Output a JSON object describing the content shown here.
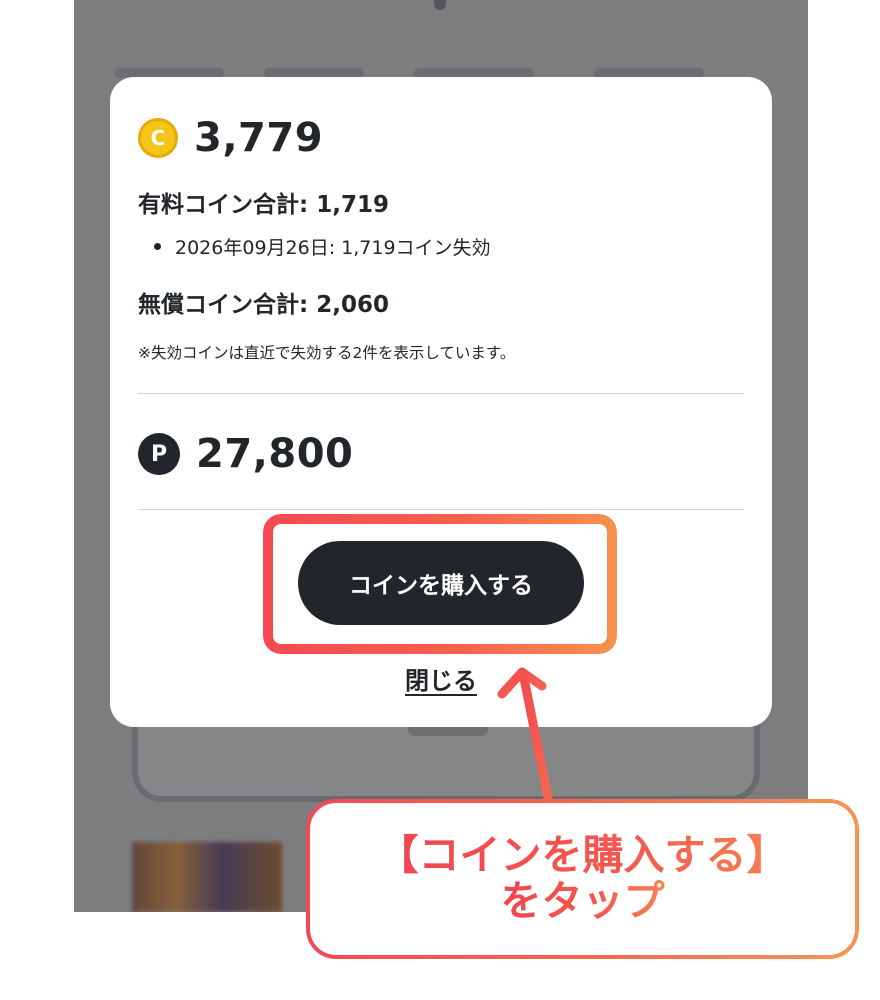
{
  "modal": {
    "coin_icon": {
      "name": "coin-icon",
      "glyph": "C",
      "color": "#f5c518"
    },
    "coin_total": "3,779",
    "paid_label": "有料コイン合計: 1,719",
    "expiry_items": [
      "2026年09月26日: 1,719コイン失効"
    ],
    "free_label": "無償コイン合計: 2,060",
    "note": "※失効コインは直近で失効する2件を表示しています。",
    "point_icon": {
      "name": "point-icon",
      "glyph": "P",
      "color": "#22262b"
    },
    "point_total": "27,800",
    "buy_button_label": "コインを購入する",
    "close_label": "閉じる"
  },
  "annotation": {
    "callout_line1": "【コインを購入する】",
    "callout_line2": "をタップ",
    "accent_color": "#f44a50",
    "accent_color_end": "#f99150"
  }
}
